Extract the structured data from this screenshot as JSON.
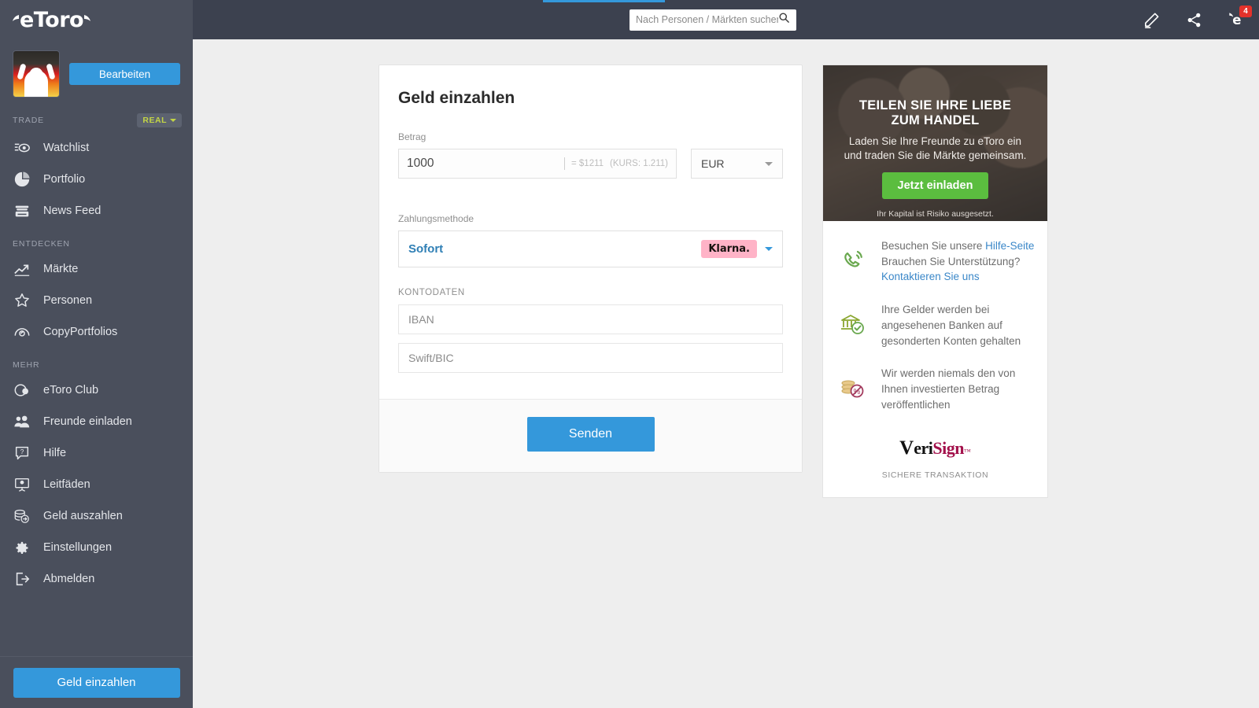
{
  "brand": {
    "name": "eToro",
    "accent_blue": "#3498db",
    "sidebar_bg": "#4a4f5c",
    "topbar_bg": "#3c414f",
    "green": "#5bbd3f",
    "badge_red": "#e4322b",
    "klarna_pink": "#ffb3c7"
  },
  "sidebar": {
    "edit_button": "Bearbeiten",
    "trade_label": "TRADE",
    "account_mode": "REAL",
    "trade_items": [
      {
        "label": "Watchlist",
        "icon": "watchlist-icon"
      },
      {
        "label": "Portfolio",
        "icon": "portfolio-icon"
      },
      {
        "label": "News Feed",
        "icon": "news-feed-icon"
      }
    ],
    "discover_label": "ENTDECKEN",
    "discover_items": [
      {
        "label": "Märkte",
        "icon": "markets-icon"
      },
      {
        "label": "Personen",
        "icon": "people-star-icon"
      },
      {
        "label": "CopyPortfolios",
        "icon": "copyportfolios-icon"
      }
    ],
    "more_label": "MEHR",
    "more_items": [
      {
        "label": "eToro Club",
        "icon": "club-icon"
      },
      {
        "label": "Freunde einladen",
        "icon": "invite-friends-icon"
      },
      {
        "label": "Hilfe",
        "icon": "help-icon"
      },
      {
        "label": "Leitfäden",
        "icon": "guides-icon"
      },
      {
        "label": "Geld auszahlen",
        "icon": "withdraw-icon"
      },
      {
        "label": "Einstellungen",
        "icon": "gear-icon"
      },
      {
        "label": "Abmelden",
        "icon": "logout-icon"
      }
    ],
    "deposit_button": "Geld einzahlen"
  },
  "topbar": {
    "search_placeholder": "Nach Personen / Märkten suchen",
    "search_value": "",
    "notification_count": "4"
  },
  "deposit_form": {
    "title": "Geld einzahlen",
    "amount_label": "Betrag",
    "amount_value": "1000",
    "conversion": "= $1211",
    "rate": "(KURS: 1.211)",
    "currency": "EUR",
    "payment_label": "Zahlungsmethode",
    "payment_method": "Sofort",
    "payment_provider": "Klarna.",
    "account_details_label": "KONTODATEN",
    "iban_placeholder": "IBAN",
    "iban_value": "",
    "swift_placeholder": "Swift/BIC",
    "swift_value": "",
    "submit_button": "Senden"
  },
  "promo": {
    "headline_line1": "TEILEN SIE IHRE LIEBE",
    "headline_line2": "ZUM HANDEL",
    "subtext_line1": "Laden Sie Ihre Freunde zu eToro ein",
    "subtext_line2": "und traden Sie die Märkte gemeinsam.",
    "cta": "Jetzt einladen",
    "risk": "Ihr Kapital ist Risiko ausgesetzt."
  },
  "info": {
    "support_pre": "Besuchen Sie unsere ",
    "support_link1": "Hilfe-Seite",
    "support_mid": " Brauchen Sie Unterstützung? ",
    "support_link2": "Kontaktieren Sie uns",
    "funds_text": "Ihre Gelder werden bei angesehenen Banken auf gesonderten Konten gehalten",
    "privacy_text": "Wir werden niemals den von Ihnen investierten Betrag veröffentlichen",
    "verisign_v": "V",
    "verisign_eri": "eri",
    "verisign_sign": "Sign",
    "verisign_tm": "™",
    "secure_caption": "SICHERE TRANSAKTION"
  }
}
